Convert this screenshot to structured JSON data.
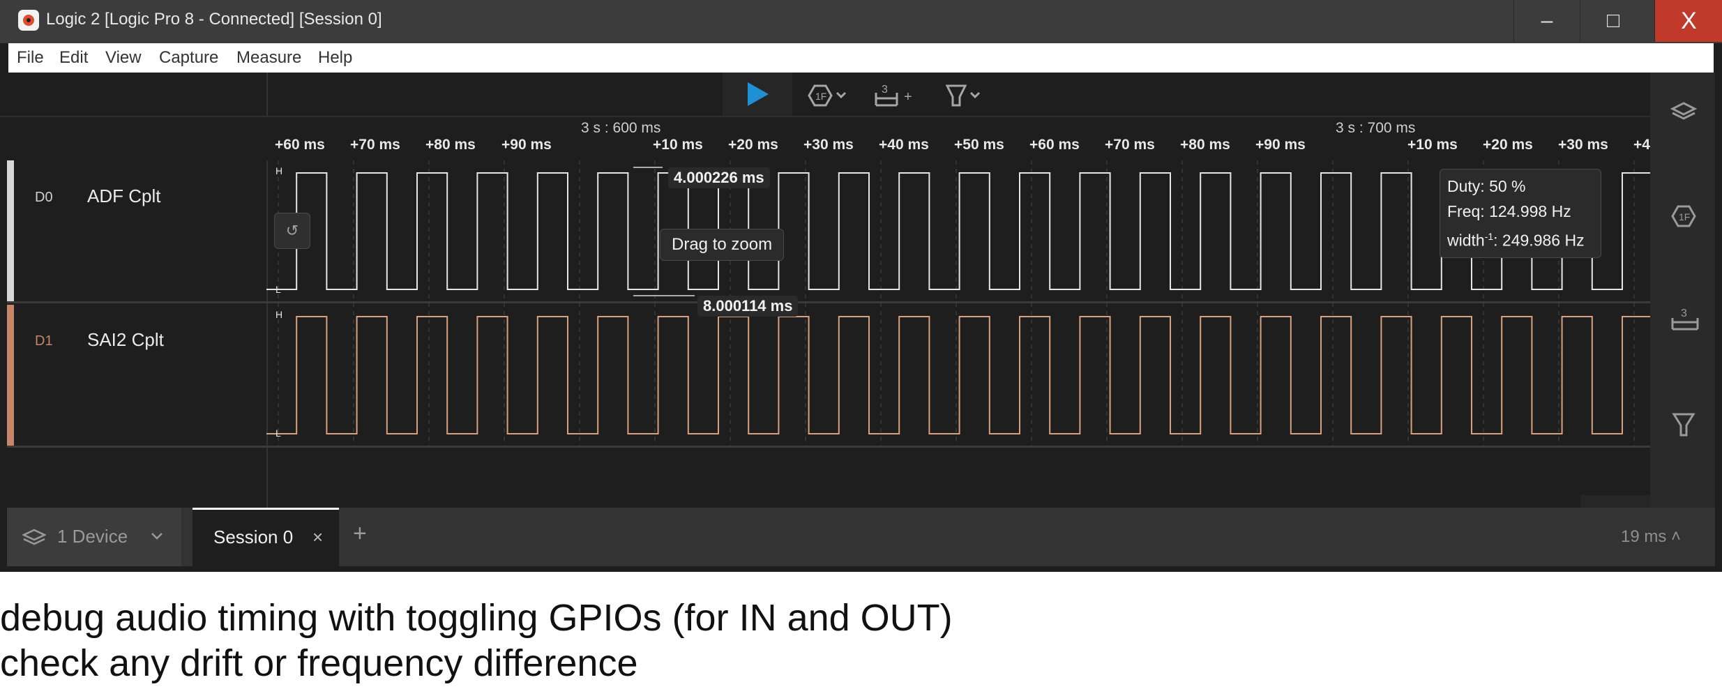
{
  "window": {
    "title": "Logic 2 [Logic Pro 8 - Connected] [Session 0]",
    "controls": {
      "minimize": "–",
      "maximize": "□",
      "close": "X"
    }
  },
  "menu": [
    "File",
    "Edit",
    "View",
    "Capture",
    "Measure",
    "Help"
  ],
  "ruler": {
    "group1": "3 s : 600 ms",
    "group2": "3 s : 700 ms",
    "ticks": [
      "+60 ms",
      "+70 ms",
      "+80 ms",
      "+90 ms",
      "+10 ms",
      "+20 ms",
      "+30 ms",
      "+40 ms",
      "+50 ms",
      "+60 ms",
      "+70 ms",
      "+80 ms",
      "+90 ms",
      "+10 ms",
      "+20 ms",
      "+30 ms",
      "+4"
    ]
  },
  "channels": [
    {
      "id": "D0",
      "name": "ADF Cplt",
      "color": "#ffffff",
      "marker_high": "H",
      "marker_low": "L"
    },
    {
      "id": "D1",
      "name": "SAI2 Cplt",
      "color": "#d9a07e",
      "marker_high": "H",
      "marker_low": "L"
    }
  ],
  "measurements": {
    "period_a": "4.000226 ms",
    "period_b": "8.000114 ms",
    "hint": "Drag to zoom"
  },
  "stats_tooltip": {
    "duty": "Duty: 50 %",
    "freq": "Freq: 124.998 Hz",
    "width_prefix": "width",
    "width_sup": "-1",
    "width_value": ": 249.986 Hz"
  },
  "bottom": {
    "device_label": "1 Device",
    "session_label": "Session 0",
    "close_glyph": "×",
    "add_glyph": "+",
    "duration": "19 ms ˄"
  },
  "caption": {
    "line1": "debug audio timing with toggling GPIOs (for IN and OUT)",
    "line2": "check any drift or frequency difference"
  },
  "icons": [
    "app-logo-icon",
    "play-icon",
    "trigger-icon",
    "measure-icon",
    "marker-icon",
    "layers-icon",
    "chevron-down-icon",
    "close-icon",
    "plus-icon"
  ],
  "colors": {
    "accent": "#1e90d6",
    "d1": "#d9a07e",
    "close": "#c0392b"
  }
}
